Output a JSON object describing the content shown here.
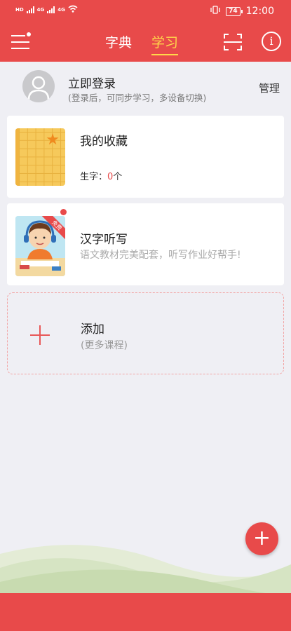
{
  "status": {
    "left_indicators": [
      "HD",
      "4G",
      "4G"
    ],
    "battery": "74",
    "time": "12:00"
  },
  "appbar": {
    "tabs": [
      {
        "label": "字典",
        "active": false
      },
      {
        "label": "学习",
        "active": true
      }
    ],
    "icons": {
      "menu": "menu-icon",
      "scan": "scan-icon",
      "info": "info-icon"
    }
  },
  "login": {
    "title": "立即登录",
    "subtitle": "(登录后，可同步学习，多设备切换)",
    "manage": "管理"
  },
  "favorites": {
    "title": "我的收藏",
    "meta_label": "生字：",
    "count": "0",
    "unit": "个"
  },
  "dictation": {
    "title": "汉字听写",
    "description": "语文教材完美配套，听写作业好帮手!",
    "badge": "免费"
  },
  "add_course": {
    "title": "添加",
    "subtitle": "(更多课程)"
  },
  "fab": {
    "label": "+"
  },
  "colors": {
    "primary": "#e84a4a",
    "accent": "#ffd84a",
    "background": "#efeff4",
    "hill_light": "#dde8c8",
    "hill_dark": "#c9ddb0"
  }
}
